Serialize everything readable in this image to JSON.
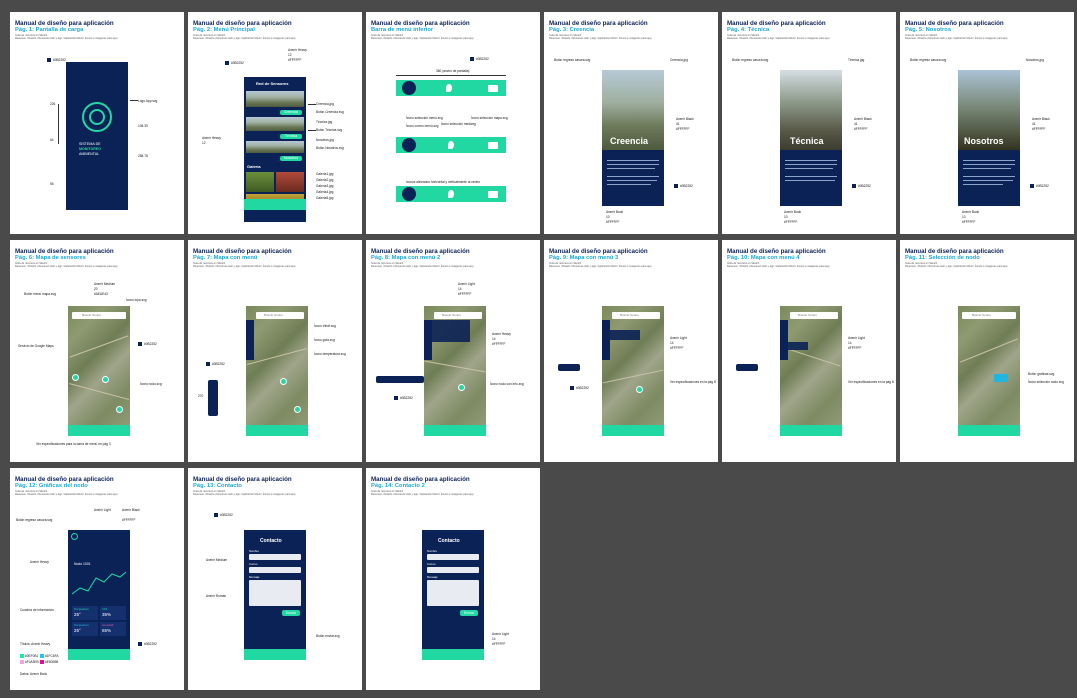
{
  "manual_title": "Manual de diseño para aplicación",
  "meta_line_1": "Guía de recursos en Sketch",
  "meta_line_2": "Resumen / Diseño / Recursos web y app / Aplicación Móvil / Íconos e imágenes para app",
  "pages": [
    {
      "subtitle": "Pág. 1: Pantalla de carga",
      "labels": {
        "color": "#0B2252",
        "logo": "Logo App.svg",
        "v1": "226",
        "v2": "108.39",
        "v3": "64",
        "v4": "258.78",
        "v5": "55"
      },
      "app_text": [
        "SISTEMA DE",
        "MONITOREO",
        "AMBIENTAL"
      ]
    },
    {
      "subtitle": "Pág. 2: Menú Principal",
      "labels": {
        "color": "#0B2252",
        "font": "Avenir Heavy",
        "size": "12",
        "hex": "#FFFFFF",
        "a1": "Creencia.jpg",
        "a2": "Botón Creencia.svg",
        "a3": "Técnica.jpg",
        "a4": "Botón Técnica.svg",
        "a5": "Nosotros.jpg",
        "a6": "Botón Nosotros.svg",
        "a7": "Galería1.jpg",
        "a8": "Galería2.jpg",
        "a9": "Galería3.jpg",
        "a10": "Galería4.jpg",
        "a11": "Galería5.jpg",
        "left_font": "Avenir Heavy",
        "left_size": "12"
      },
      "app_header": "Red de Sensores",
      "gallery": "Galería",
      "buttons": [
        "Creencia",
        "Técnica",
        "Nosotros"
      ]
    },
    {
      "subtitle": "Barra de menú inferior",
      "labels": {
        "color": "#0B2252",
        "top": "360 (ancho de pantalla)",
        "b1": "Ícono selección menú.svg",
        "b2": "Ícono selección mapa.svg",
        "b3": "Ícono selección mediceg",
        "b4": "Ícono correo menú.svg",
        "b5": "Iconos alineados horizontal y verticalmente al centro"
      }
    },
    {
      "subtitle": "Pág. 3: Creencia",
      "labels": {
        "back": "Botón regreso casura.svg",
        "img": "Creencia.jpg",
        "font": "Avenir Black",
        "size": "41",
        "hex": "#FFFFFF",
        "color": "#0B2252",
        "font2": "Avenir Book",
        "size2": "10",
        "hex2": "#FFFFFF"
      },
      "hero": "Creencia"
    },
    {
      "subtitle": "Pág. 4: Técnica",
      "labels": {
        "back": "Botón regreso casura.svg",
        "img": "Técnica.jpg",
        "font": "Avenir Black",
        "size": "41",
        "hex": "#FFFFFF",
        "color": "#0B2252",
        "font2": "Avenir Book",
        "size2": "10",
        "hex2": "#FFFFFF"
      },
      "hero": "Técnica"
    },
    {
      "subtitle": "Pág. 5: Nosotros",
      "labels": {
        "back": "Botón regreso casura.svg",
        "img": "Nosotros.jpg",
        "font": "Avenir Black",
        "size": "41",
        "hex": "#FFFFFF",
        "color": "#0B2252",
        "font2": "Avenir Book",
        "size2": "10",
        "hex2": "#FFFFFF"
      },
      "hero": "Nosotros"
    },
    {
      "subtitle": "Pág. 6: Mapa de sensores",
      "labels": {
        "back": "Botón menú mapa.svg",
        "font": "Avenir Medium",
        "size": "20",
        "hex": "#AEAE43",
        "icon": "Ícono lupa.svg",
        "maps": "Servicio de Google Maps",
        "color": "#0B2252",
        "node": "Ícono nodo.svg",
        "spec": "Ver especificaciones para la barra de menú en pág 3"
      },
      "search": "Buscar Nodos"
    },
    {
      "subtitle": "Pág. 7: Mapa con menú",
      "labels": {
        "i1": "Ícono Infraf.svg",
        "i2": "Ícono gota.svg",
        "i3": "Ícono temperatura.svg",
        "color": "#0B2252",
        "v": "270"
      },
      "search": "Buscar Nodos"
    },
    {
      "subtitle": "Pág. 8: Mapa con menú 2",
      "labels": {
        "font": "Avenir Light",
        "size": "14",
        "hex": "#FFFFFF",
        "font2": "Avenir Heavy",
        "size2": "14",
        "hex2": "#FFFFFF",
        "node": "Ícono nodo con info.svg",
        "color": "#0B2252"
      },
      "search": "Buscar Nodos"
    },
    {
      "subtitle": "Pág. 9: Mapa con menú 3",
      "labels": {
        "font": "Avenir Light",
        "size": "14",
        "hex": "#FFFFFF",
        "font2": "Avenir Heavy",
        "size2": "14",
        "hex2": "#FFFFFF",
        "spec": "Ver especificaciones en la pág 8",
        "color": "#0B2252"
      },
      "search": "Buscar Nodos"
    },
    {
      "subtitle": "Pág. 10: Mapa con menú 4",
      "labels": {
        "font": "Avenir Light",
        "size": "14",
        "hex": "#FFFFFF",
        "spec": "Ver especificaciones en la pág 8"
      },
      "search": "Buscar Nodos"
    },
    {
      "subtitle": "Pág. 11: Selección de nodo",
      "labels": {
        "g": "Botón gráficas.svg",
        "n": "Ícono selección nodo.svg"
      },
      "search": "Buscar Nodos"
    },
    {
      "subtitle": "Pág. 12: Gráficas del nodo",
      "labels": {
        "back": "Botón regreso casura.svg",
        "font": "Avenir Light",
        "font2": "Avenir Black",
        "hex": "#FFFFFF",
        "heavy": "Avenir Heavy",
        "info": "Cuadros de información",
        "titles": "Títulos: Avenir Heavy",
        "data": "Datos: Avenir Book",
        "c1": "#0EF0B1",
        "c2": "#1FC6FA",
        "c3": "#F0A3EB",
        "c4": "#E50B98",
        "color": "#0B2252"
      },
      "chart_title": "Nodo 1001",
      "cells": [
        {
          "k": "Temperatura",
          "v": "25°"
        },
        {
          "k": "CO2",
          "v": "35%"
        },
        {
          "k": "Temperatura",
          "v": "25°"
        },
        {
          "k": "Humedad",
          "v": "65%"
        }
      ]
    },
    {
      "subtitle": "Pág. 13: Contacto",
      "labels": {
        "color": "#0B2252",
        "font": "Avenir Medium",
        "font2": "Avenir Roman",
        "send": "Botón enviar.svg"
      },
      "app_header": "Contacto",
      "fields": [
        "Nombre",
        "Correo",
        "Mensaje"
      ],
      "send": "Enviar"
    },
    {
      "subtitle": "Pág. 14: Contacto 2",
      "labels": {
        "font": "Avenir Light",
        "size": "14",
        "hex": "#FFFFFF"
      },
      "app_header": "Contacto",
      "fields": [
        "Nombre",
        "Correo",
        "Mensaje"
      ],
      "send": "Enviar"
    }
  ]
}
